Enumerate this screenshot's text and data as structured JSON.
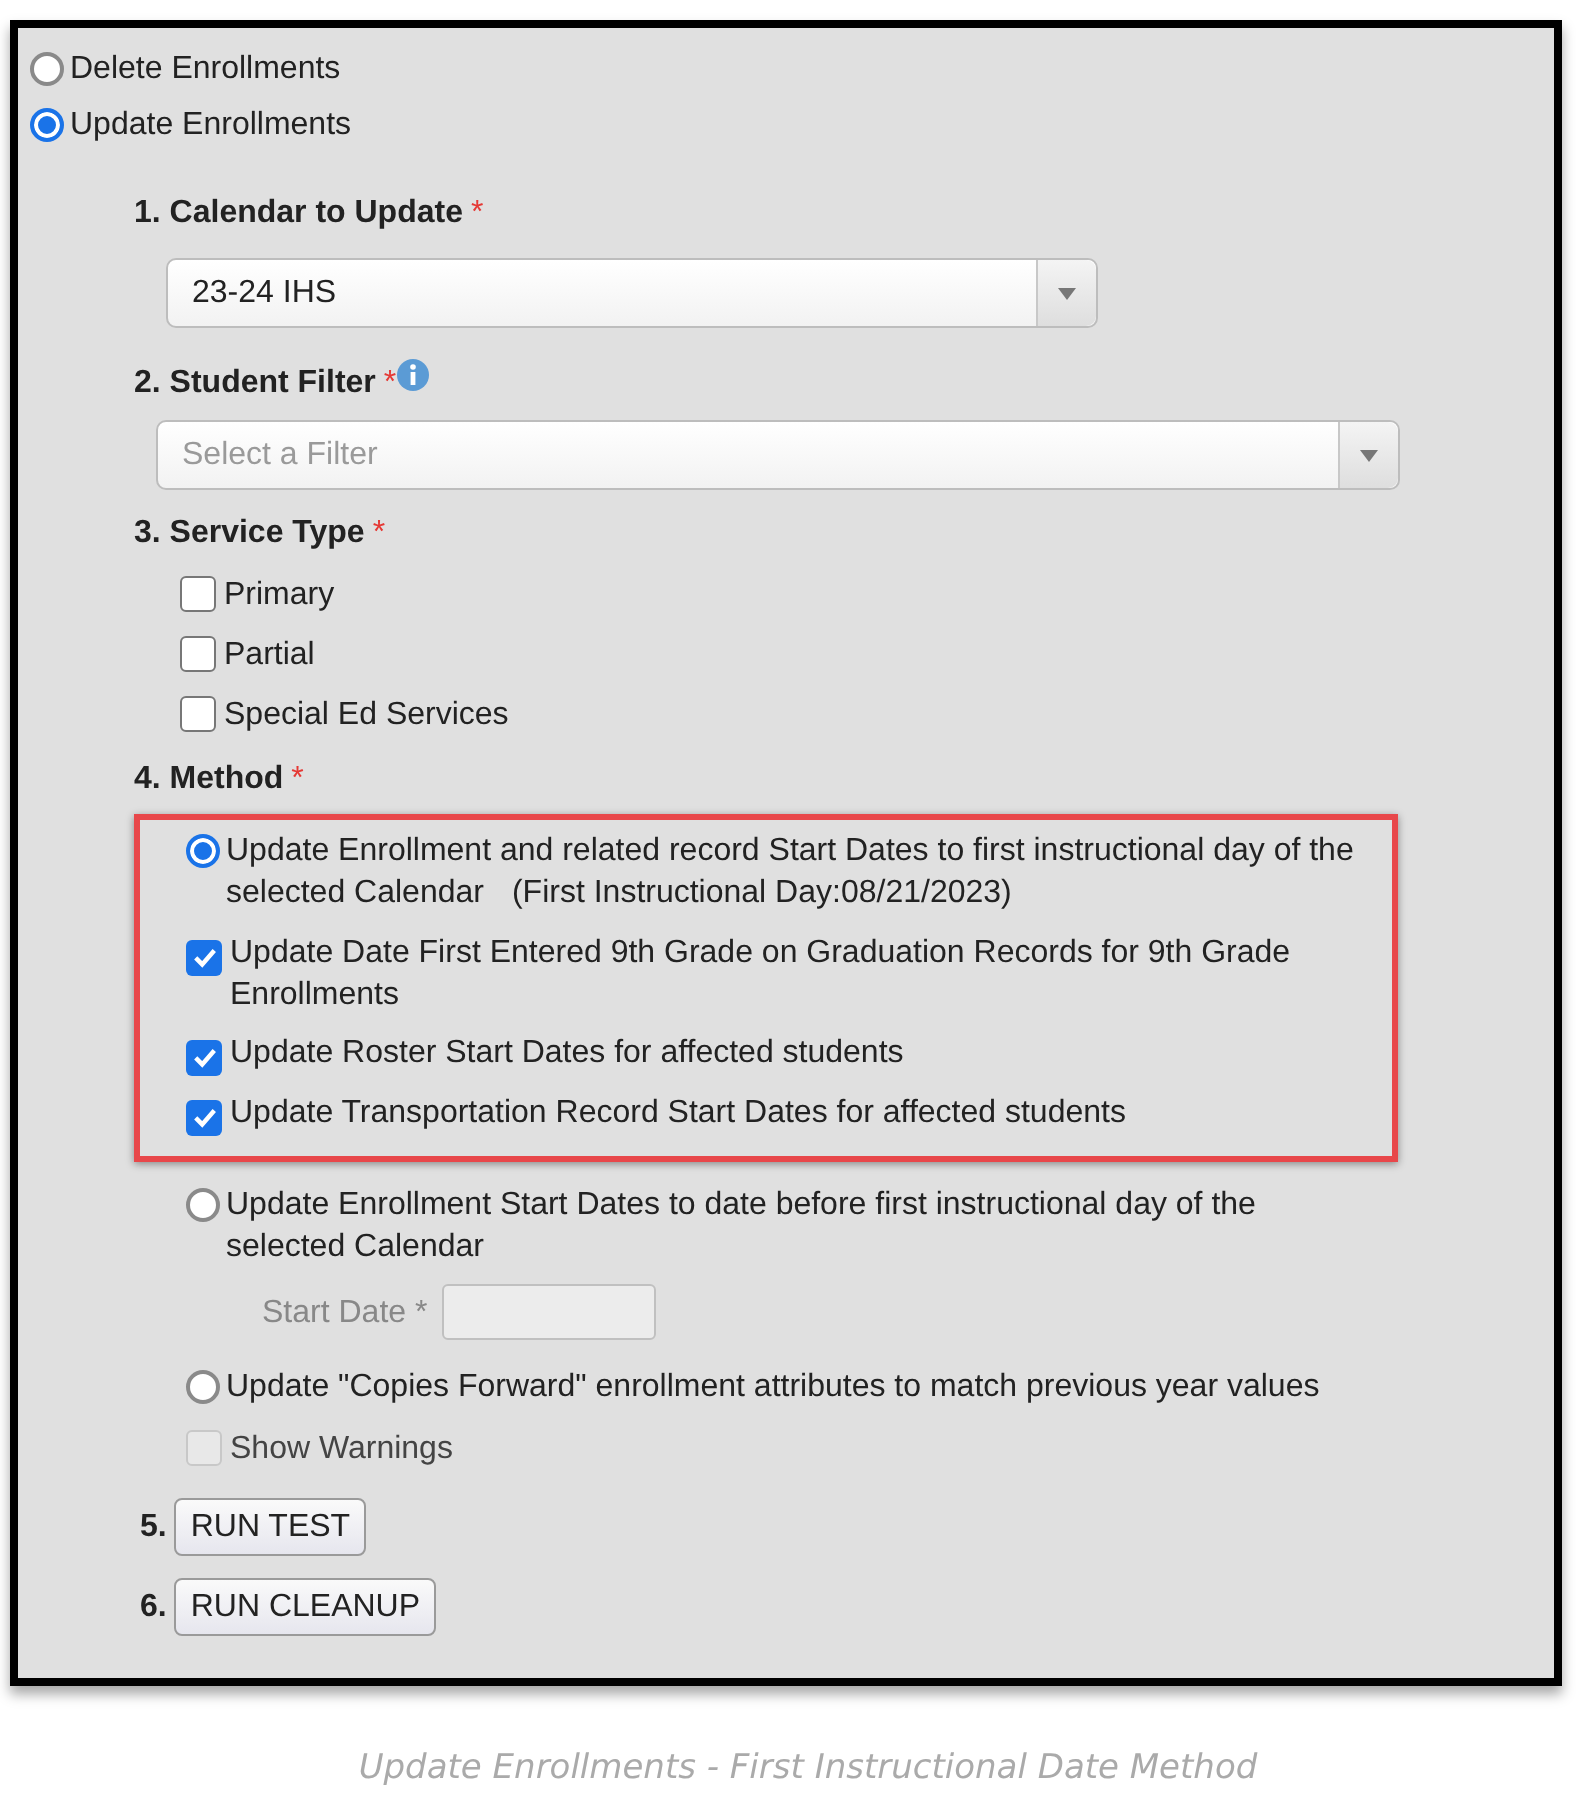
{
  "top_options": [
    {
      "label": "Delete Enrollments",
      "selected": false
    },
    {
      "label": "Update Enrollments",
      "selected": true
    }
  ],
  "calendar": {
    "label": "1. Calendar to Update",
    "required_mark": "*",
    "value": "23-24 IHS"
  },
  "student_filter": {
    "label": "2. Student Filter",
    "required_mark": "*",
    "placeholder": "Select a Filter"
  },
  "service_type": {
    "label": "3. Service Type",
    "required_mark": "*",
    "options": [
      {
        "label": "Primary",
        "checked": false
      },
      {
        "label": "Partial",
        "checked": false
      },
      {
        "label": "Special Ed Services",
        "checked": false
      }
    ]
  },
  "method": {
    "label": "4. Method",
    "required_mark": "*",
    "options": [
      {
        "label": "Update Enrollment and related record Start Dates to first instructional day of the selected Calendar",
        "note": "(First Instructional Day:08/21/2023)",
        "selected": true,
        "highlighted": true,
        "sub_items": [
          {
            "kind": "checkbox",
            "label": "Update Date First Entered 9th Grade on Graduation Records for 9th Grade Enrollments",
            "checked": true
          },
          {
            "kind": "checkbox",
            "label": "Update Roster Start Dates for affected students",
            "checked": true
          },
          {
            "kind": "checkbox",
            "label": "Update Transportation Record Start Dates for affected students",
            "checked": true
          }
        ]
      },
      {
        "label": "Update Enrollment Start Dates to date before first instructional day of the selected Calendar",
        "selected": false,
        "highlighted": false,
        "sub_items": [
          {
            "kind": "date_field",
            "label": "Start Date *",
            "disabled": true
          }
        ]
      },
      {
        "label": "Update \"Copies Forward\" enrollment attributes to match previous year values",
        "selected": false,
        "highlighted": false,
        "sub_items": [
          {
            "kind": "checkbox",
            "label": "Show Warnings",
            "checked": false,
            "disabled": true
          }
        ]
      }
    ]
  },
  "actions": [
    {
      "number": "5.",
      "label": "RUN TEST"
    },
    {
      "number": "6.",
      "label": "RUN CLEANUP"
    }
  ],
  "caption": "Update Enrollments - First Instructional Date Method"
}
